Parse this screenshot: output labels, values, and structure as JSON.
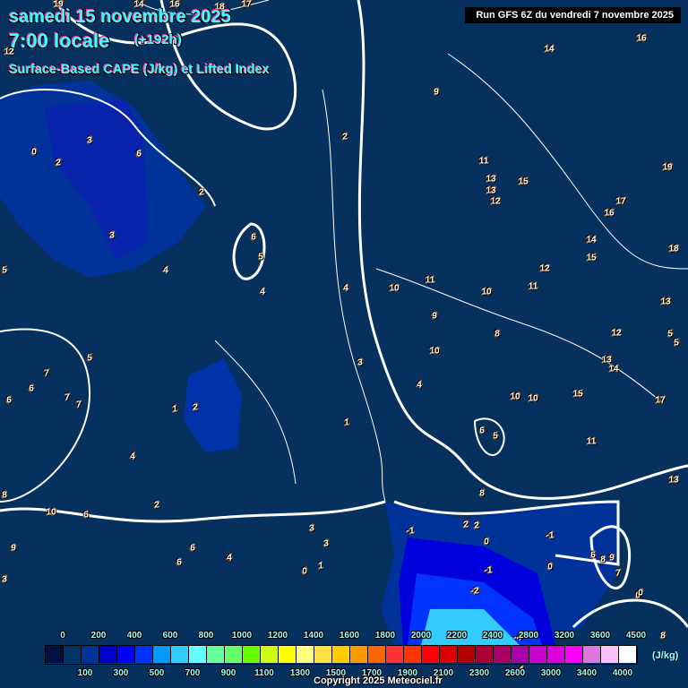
{
  "header": {
    "date": "samedi 15 novembre 2025",
    "time": "7:00 locale",
    "lead": "(+192h)",
    "parameter": "Surface-Based CAPE (J/kg) et Lifted Index",
    "run": "Run GFS 6Z du vendredi 7 novembre 2025"
  },
  "legend": {
    "unit": "(J/kg)",
    "top_labels": [
      "0",
      "200",
      "400",
      "600",
      "800",
      "1000",
      "1200",
      "1400",
      "1600",
      "1800",
      "2000",
      "2200",
      "2400",
      "2800",
      "3200",
      "3600",
      "4500"
    ],
    "bottom_labels": [
      "100",
      "300",
      "500",
      "700",
      "900",
      "1100",
      "1300",
      "1500",
      "1700",
      "1900",
      "2100",
      "2300",
      "2600",
      "3000",
      "3400",
      "4000"
    ],
    "colors": [
      "#001040",
      "#003366",
      "#003399",
      "#0000cc",
      "#0000ff",
      "#0033ff",
      "#0099ff",
      "#33ccff",
      "#66ffff",
      "#66ff99",
      "#66ff66",
      "#66ff00",
      "#ccff11",
      "#ffff00",
      "#ffff80",
      "#ffe040",
      "#ffcc00",
      "#ff9900",
      "#ff6600",
      "#ff3333",
      "#ff3300",
      "#ff0000",
      "#dd0000",
      "#b30000",
      "#aa0033",
      "#aa0066",
      "#aa00aa",
      "#cc00cc",
      "#dd00dd",
      "#ff00ff",
      "#dd77dd",
      "#ffc0ff",
      "#ffffff"
    ]
  },
  "lifted_index_labels": [
    "19",
    "14",
    "16",
    "18",
    "17",
    "12",
    "9",
    "14",
    "16",
    "0",
    "2",
    "3",
    "6",
    "2",
    "3",
    "6",
    "5",
    "4",
    "4",
    "5",
    "2",
    "11",
    "13",
    "13",
    "12",
    "15",
    "17",
    "16",
    "18",
    "19",
    "14",
    "15",
    "12",
    "11",
    "10",
    "9",
    "11",
    "10",
    "8",
    "10",
    "13",
    "12",
    "14",
    "13",
    "5",
    "5",
    "4",
    "3",
    "15",
    "10",
    "10",
    "17",
    "6",
    "5",
    "11",
    "4",
    "1",
    "2",
    "8",
    "13",
    "7",
    "6",
    "7",
    "7",
    "6",
    "5",
    "4",
    "2",
    "1",
    "8",
    "10",
    "6",
    "9",
    "6",
    "6",
    "2",
    "4",
    "3",
    "3",
    "1",
    "0",
    "-1",
    "2",
    "0",
    "-1",
    "-1",
    "0",
    "-2",
    "3",
    "6",
    "8",
    "9",
    "7",
    "0",
    "0",
    "-4",
    "-4",
    "8"
  ],
  "copyright": "Copyright 2025 Meteociel.fr"
}
